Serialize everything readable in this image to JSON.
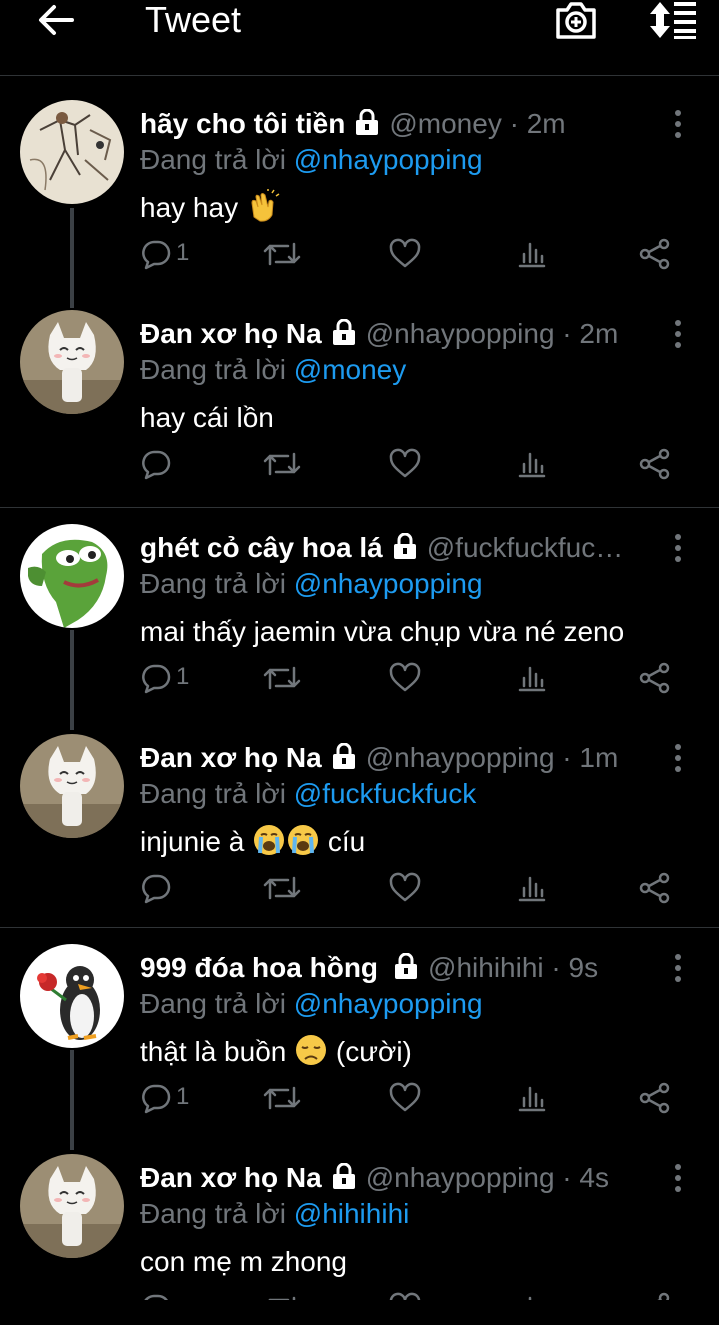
{
  "header": {
    "title": "Tweet",
    "back_icon": "arrow-left-icon",
    "camera_icon": "camera-plus-icon",
    "sort_icon": "sort-icon"
  },
  "colors": {
    "background": "#000000",
    "text": "#ffffff",
    "muted": "#71767b",
    "mention": "#1d9bf0",
    "divider": "#2f3336"
  },
  "reply_prefix": "Đang trả lời",
  "tweets": [
    {
      "name": "hãy cho tôi tiền",
      "handle": "@money",
      "time": "2m",
      "reply_to": "@nhaypopping",
      "text": "hay hay",
      "emoji": "clapping-hands",
      "reply_count": "1",
      "avatar": "sketch-doodle"
    },
    {
      "name": "Đan xơ họ Na",
      "handle": "@nhaypopping",
      "time": "2m",
      "reply_to": "@money",
      "text": "hay cái lồn",
      "reply_count": "",
      "avatar": "white-cat-figure"
    },
    {
      "name": "ghét cỏ cây hoa lá",
      "handle": "@fuckfuckfuc…",
      "time": "",
      "reply_to": "@nhaypopping",
      "text": "mai thấy jaemin vừa chụp vừa né zeno",
      "reply_count": "1",
      "avatar": "green-frog"
    },
    {
      "name": "Đan xơ họ Na",
      "handle": "@nhaypopping",
      "time": "1m",
      "reply_to": "@fuckfuckfuck",
      "text_before": "injunie à",
      "text_after": "cíu",
      "emoji": "loudly-crying-face",
      "reply_count": "",
      "avatar": "white-cat-figure"
    },
    {
      "name": "999 đóa hoa hồng",
      "handle": "@hihihihi",
      "time": "9s",
      "reply_to": "@nhaypopping",
      "text_before": "thật là buồn",
      "text_after": "(cười)",
      "emoji": "disappointed-face",
      "reply_count": "1",
      "avatar": "penguin-with-rose"
    },
    {
      "name": "Đan xơ họ Na",
      "handle": "@nhaypopping",
      "time": "4s",
      "reply_to": "@hihihihi",
      "text": "con mẹ m zhong",
      "reply_count": "",
      "avatar": "white-cat-figure"
    }
  ]
}
